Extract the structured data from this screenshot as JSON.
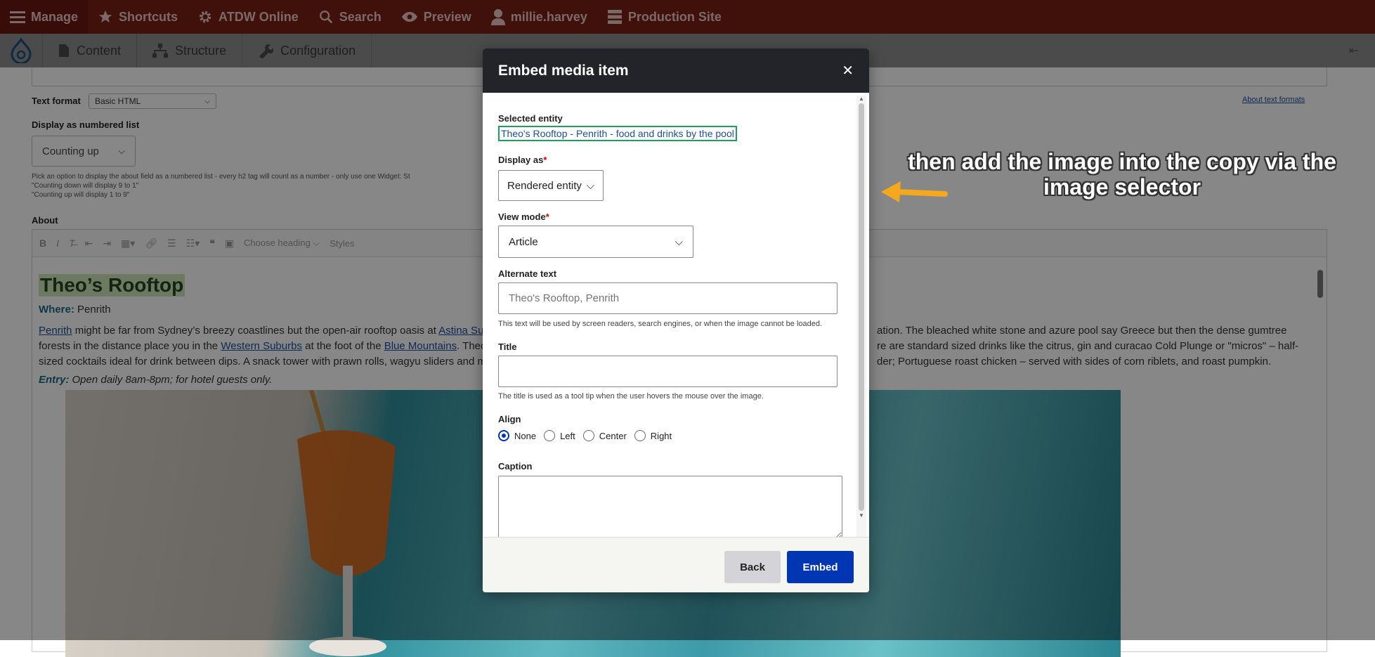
{
  "toolbar": {
    "manage": "Manage",
    "shortcuts": "Shortcuts",
    "atdw": "ATDW Online",
    "search": "Search",
    "preview": "Preview",
    "user": "millie.harvey",
    "production": "Production Site",
    "color": "#7a2015"
  },
  "tray": {
    "content": "Content",
    "structure": "Structure",
    "configuration": "Configuration"
  },
  "form": {
    "text_format_label": "Text format",
    "text_format_value": "Basic HTML",
    "about_text_formats": "About text formats",
    "numbered_label": "Display as numbered list",
    "numbered_value": "Counting up",
    "numbered_help_1": "Pick an option to display the about field as a numbered list - every h2 tag will count as a number - only use one Widget: St",
    "numbered_help_2": "\"Counting down will display 9 to 1\"",
    "numbered_help_3": "\"Counting up will display 1 to 9\"",
    "about_label": "About",
    "toolbar_heading": "Choose heading",
    "toolbar_styles": "Styles"
  },
  "article": {
    "heading": "Theo’s Rooftop",
    "where_label": "Where:",
    "where_value": " Penrith",
    "link_penrith": "Penrith",
    "text_1": " might be far from Sydney’s breezy coastlines but the open-air rooftop oasis at ",
    "link_astina": "Astina Su",
    "text_1_end": "ation. The bleached white stone and azure pool say Greece but then the dense gumtree",
    "text_2": "forests in the distance place you in the ",
    "link_western": "Western Suburbs",
    "text_2b": " at the foot of the ",
    "link_blue": "Blue Mountains",
    "text_2c": ". Theo",
    "text_2_end": "re are standard sized drinks like the citrus, gin and curacao Cold Plunge or \"micros\" – half-",
    "text_3": "sized cocktails ideal for drink between dips. A snack tower with prawn rolls, wagyu sliders and m",
    "text_3_end": "der; Portuguese roast chicken – served with sides of corn riblets, and roast pumpkin.",
    "entry_label": "Entry:",
    "entry_value": " Open daily 8am-8pm; for hotel guests only."
  },
  "modal": {
    "title": "Embed media item",
    "selected_label": "Selected entity",
    "selected_value": "Theo's Rooftop - Penrith - food and drinks by the pool",
    "display_as_label": "Display as",
    "display_as_value": "Rendered entity",
    "view_mode_label": "View mode",
    "view_mode_value": "Article",
    "alt_label": "Alternate text",
    "alt_placeholder": "Theo's Rooftop, Penrith",
    "alt_desc": "This text will be used by screen readers, search engines, or when the image cannot be loaded.",
    "title_label": "Title",
    "title_value": "",
    "title_desc": "The title is used as a tool tip when the user hovers the mouse over the image.",
    "align_label": "Align",
    "align_options": [
      "None",
      "Left",
      "Center",
      "Right"
    ],
    "align_selected": "None",
    "caption_label": "Caption",
    "caption_value": "",
    "back": "Back",
    "embed": "Embed",
    "accent": "#0036b1"
  },
  "annotation": "then add the image into the copy via the image selector"
}
